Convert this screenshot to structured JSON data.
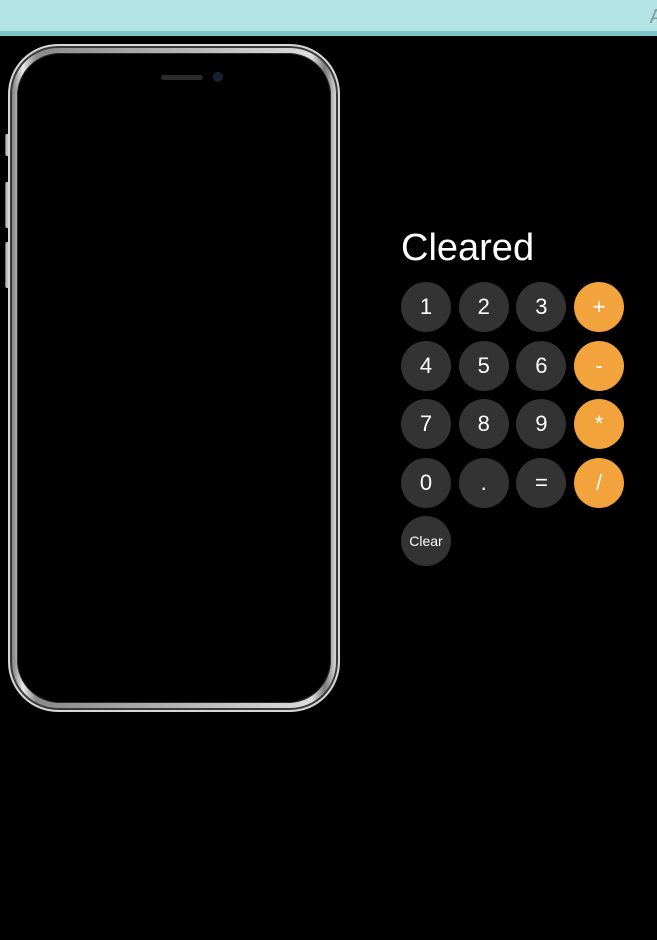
{
  "browser": {
    "topbar_text": "A"
  },
  "calculator": {
    "display": "Cleared",
    "keys": [
      {
        "label": "1",
        "type": "digit"
      },
      {
        "label": "2",
        "type": "digit"
      },
      {
        "label": "3",
        "type": "digit"
      },
      {
        "label": "+",
        "type": "operator"
      },
      {
        "label": "4",
        "type": "digit"
      },
      {
        "label": "5",
        "type": "digit"
      },
      {
        "label": "6",
        "type": "digit"
      },
      {
        "label": "-",
        "type": "operator"
      },
      {
        "label": "7",
        "type": "digit"
      },
      {
        "label": "8",
        "type": "digit"
      },
      {
        "label": "9",
        "type": "digit"
      },
      {
        "label": "*",
        "type": "operator"
      },
      {
        "label": "0",
        "type": "digit"
      },
      {
        "label": ".",
        "type": "digit"
      },
      {
        "label": "=",
        "type": "digit"
      },
      {
        "label": "/",
        "type": "operator"
      },
      {
        "label": "Clear",
        "type": "clear"
      }
    ]
  },
  "colors": {
    "key_bg": "#333333",
    "operator_bg": "#f2a33c",
    "topbar_bg": "#b3e3e4"
  }
}
